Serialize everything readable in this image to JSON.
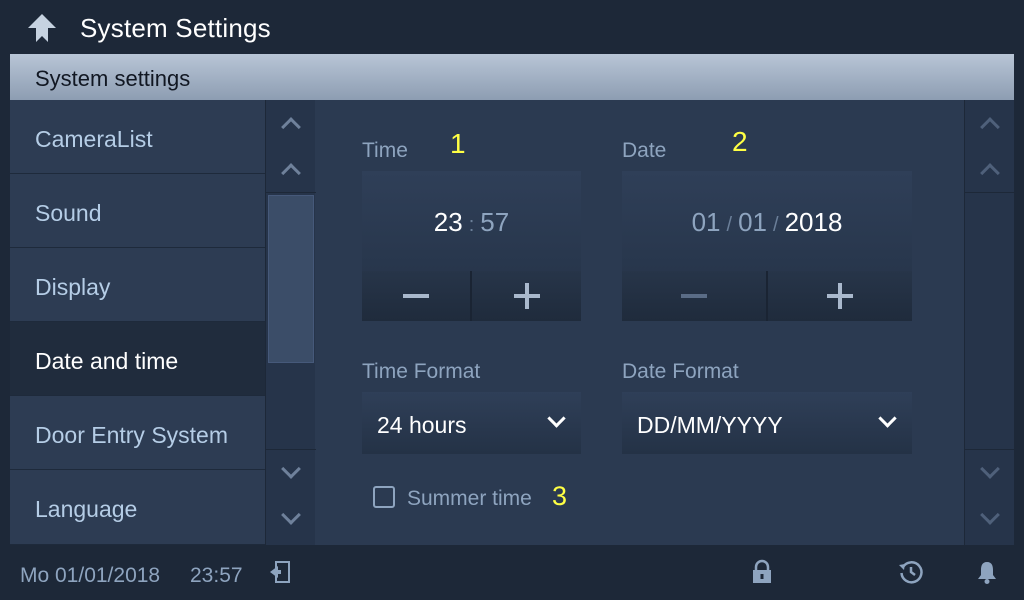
{
  "header": {
    "title": "System Settings",
    "back_icon": "back-arrow-icon"
  },
  "panel": {
    "title": "System settings"
  },
  "sidebar": {
    "items": [
      {
        "label": "CameraList"
      },
      {
        "label": "Sound"
      },
      {
        "label": "Display"
      },
      {
        "label": "Date and time",
        "active": true
      },
      {
        "label": "Door Entry System"
      },
      {
        "label": "Language"
      }
    ]
  },
  "time": {
    "label": "Time",
    "marker": "1",
    "hours": "23",
    "separator": ":",
    "minutes": "57"
  },
  "date": {
    "label": "Date",
    "marker": "2",
    "day": "01",
    "month": "01",
    "year": "2018",
    "separator": "/"
  },
  "time_format": {
    "label": "Time Format",
    "value": "24 hours"
  },
  "date_format": {
    "label": "Date Format",
    "value": "DD/MM/YYYY"
  },
  "summer_time": {
    "label": "Summer time",
    "marker": "3",
    "checked": false
  },
  "status_bar": {
    "date": "Mo 01/01/2018",
    "time": "23:57"
  },
  "colors": {
    "background": "#1d2838",
    "panel": "#2b3a51",
    "marker": "#ffff44",
    "muted_text": "#8ea4bf"
  }
}
